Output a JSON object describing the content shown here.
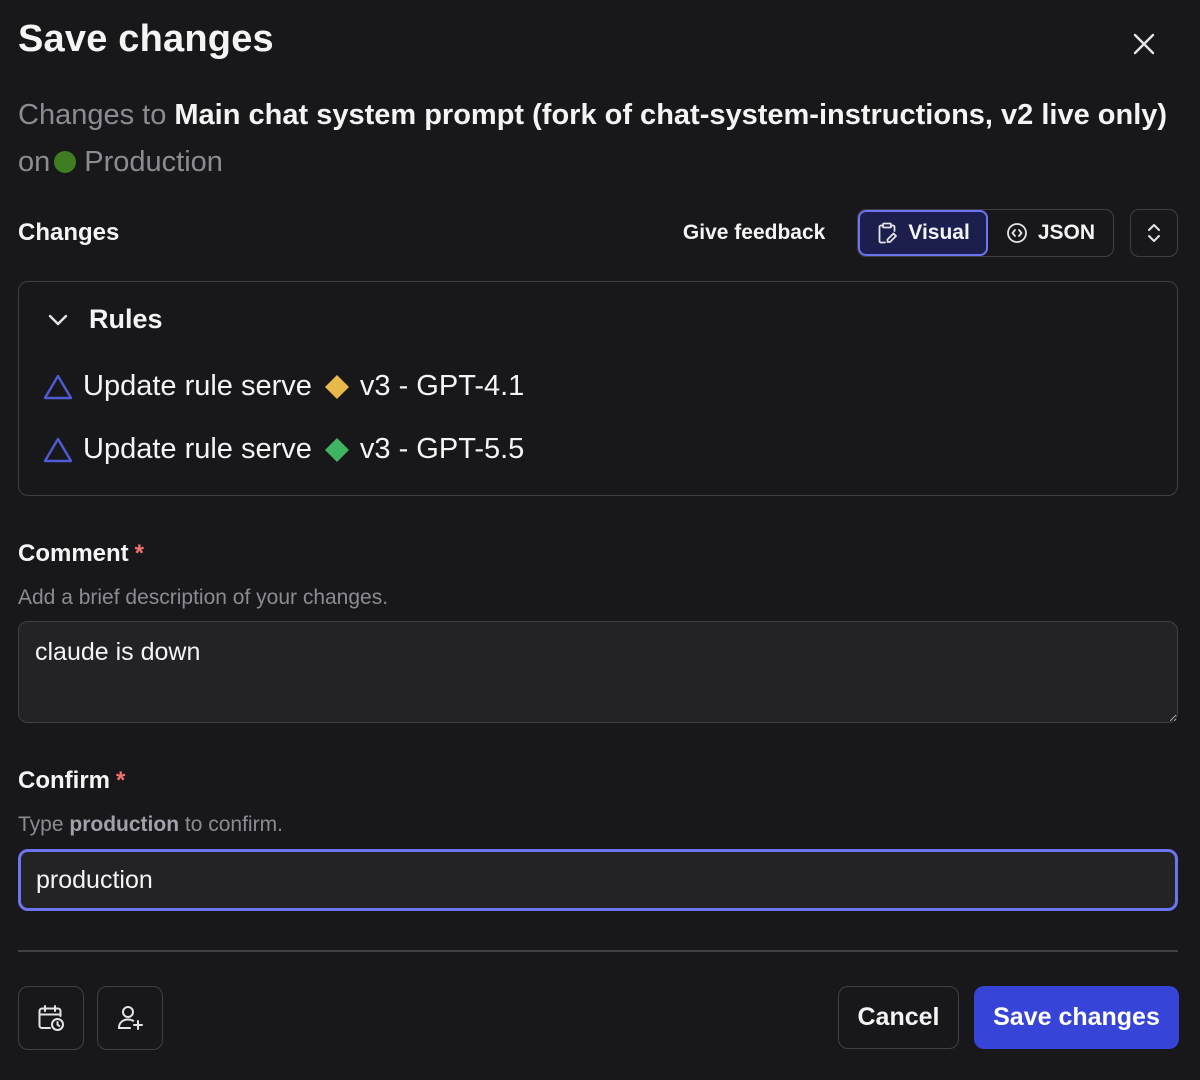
{
  "dialog": {
    "title": "Save changes",
    "close_icon": "close-icon"
  },
  "subtitle": {
    "prefix": "Changes to",
    "target_name": "Main chat system prompt (fork of chat-system-instructions, v2 live only)",
    "on_word": "on",
    "environment": "Production",
    "environment_color": "#3f7d22"
  },
  "changes": {
    "heading": "Changes",
    "feedback_label": "Give feedback",
    "view_tabs": [
      {
        "label": "Visual",
        "icon": "clipboard-edit-icon",
        "active": true
      },
      {
        "label": "JSON",
        "icon": "code-circle-icon",
        "active": false
      }
    ],
    "expand_icon": "chevrons-up-down-icon"
  },
  "rules": {
    "heading": "Rules",
    "items": [
      {
        "text": "Update rule serve",
        "variant": "v3 - GPT-4.1",
        "variant_color": "#e8b84a",
        "icon": "triangle-icon"
      },
      {
        "text": "Update rule serve",
        "variant": "v3 - GPT-5.5",
        "variant_color": "#3fb463",
        "icon": "triangle-icon"
      }
    ]
  },
  "comment": {
    "label": "Comment",
    "required_mark": "*",
    "help": "Add a brief description of your changes.",
    "value": "claude is down"
  },
  "confirm": {
    "label": "Confirm",
    "required_mark": "*",
    "help_prefix": "Type",
    "help_keyword": "production",
    "help_suffix": "to confirm.",
    "value": "production"
  },
  "footer": {
    "schedule_icon": "calendar-clock-icon",
    "reviewer_icon": "user-plus-icon",
    "cancel_label": "Cancel",
    "save_label": "Save changes"
  },
  "colors": {
    "background": "#18181b",
    "accent": "#3744d8",
    "focus_ring": "#6d74f0",
    "triangle": "#4f5bd5",
    "required": "#f87171"
  }
}
